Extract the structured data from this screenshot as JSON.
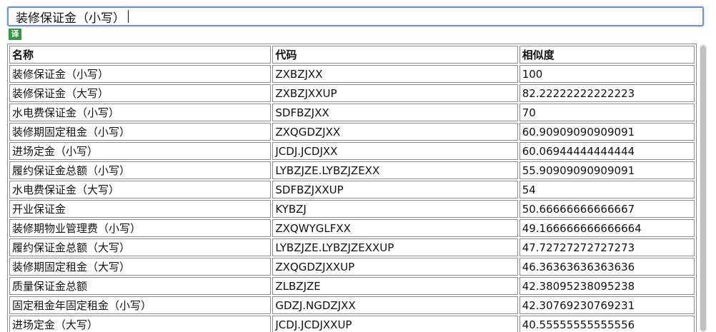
{
  "search": {
    "value": "装修保证金（小写）"
  },
  "translate_badge": "译",
  "table": {
    "headers": [
      "名称",
      "代码",
      "相似度"
    ],
    "rows": [
      [
        "装修保证金（小写）",
        "ZXBZJXX",
        "100"
      ],
      [
        "装修保证金（大写）",
        "ZXBZJXXUP",
        "82.22222222222223"
      ],
      [
        "水电费保证金（小写）",
        "SDFBZJXX",
        "70"
      ],
      [
        "装修期固定租金（小写）",
        "ZXQGDZJXX",
        "60.90909090909091"
      ],
      [
        "进场定金（小写）",
        "JCDJ.JCDJXX",
        "60.06944444444444"
      ],
      [
        "履约保证金总额（小写）",
        "LYBZJZE.LYBZJZEXX",
        "55.90909090909091"
      ],
      [
        "水电费保证金（大写）",
        "SDFBZJXXUP",
        "54"
      ],
      [
        "开业保证金",
        "KYBZJ",
        "50.66666666666667"
      ],
      [
        "装修期物业管理费（小写）",
        "ZXQWYGLFXX",
        "49.166666666666664"
      ],
      [
        "履约保证金总额（大写）",
        "LYBZJZE.LYBZJZEXXUP",
        "47.72727272727273"
      ],
      [
        "装修期固定租金（大写）",
        "ZXQGDZJXXUP",
        "46.36363636363636"
      ],
      [
        "质量保证金总额",
        "ZLBZJZE",
        "42.38095238095238"
      ],
      [
        "固定租金年固定租金（小写）",
        "GDZJ.NGDZJXX",
        "42.30769230769231"
      ],
      [
        "进场定金（大写）",
        "JCDJ.JCDJXXUP",
        "40.55555555555556"
      ]
    ]
  }
}
